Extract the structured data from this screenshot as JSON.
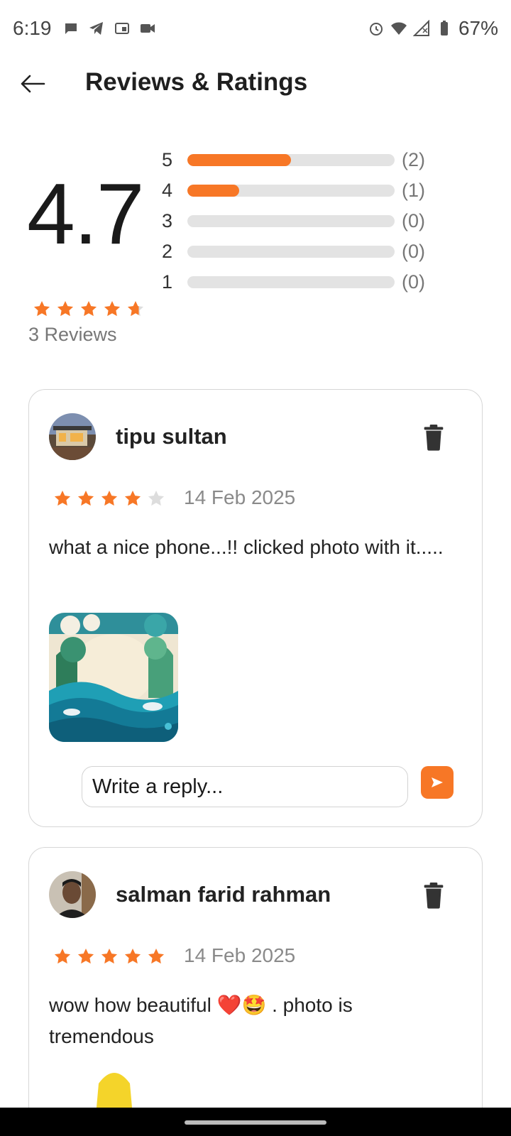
{
  "status_bar": {
    "time": "6:19",
    "battery": "67%",
    "left_icons": [
      "chat-bubble-icon",
      "telegram-icon",
      "cast-icon",
      "video-call-icon"
    ],
    "right_icons": [
      "alarm-icon",
      "wifi-icon",
      "signal-icon",
      "battery-icon"
    ]
  },
  "app_bar": {
    "title": "Reviews & Ratings",
    "back_icon": "arrow-back-icon"
  },
  "summary": {
    "average": "4.7",
    "average_stars_value": 4.7,
    "reviews_label": "3 Reviews",
    "distribution": [
      {
        "star": "5",
        "count_label": "(2)",
        "fraction": 0.5
      },
      {
        "star": "4",
        "count_label": "(1)",
        "fraction": 0.25
      },
      {
        "star": "3",
        "count_label": "(0)",
        "fraction": 0
      },
      {
        "star": "2",
        "count_label": "(0)",
        "fraction": 0
      },
      {
        "star": "1",
        "count_label": "(0)",
        "fraction": 0
      }
    ]
  },
  "reviews": [
    {
      "name": "tipu sultan",
      "rating": 4,
      "date": "14 Feb 2025",
      "text": "what a nice phone...!! clicked photo with it.....",
      "has_photo": true,
      "reply_placeholder": "Write a reply..."
    },
    {
      "name": "salman farid rahman",
      "rating": 5,
      "date": "14 Feb 2025",
      "text": "wow how beautiful ❤️🤩 . photo is tremendous",
      "has_photo": true
    }
  ],
  "colors": {
    "accent": "#f77726",
    "track": "#e3e3e3",
    "empty_star": "#dddddd"
  }
}
